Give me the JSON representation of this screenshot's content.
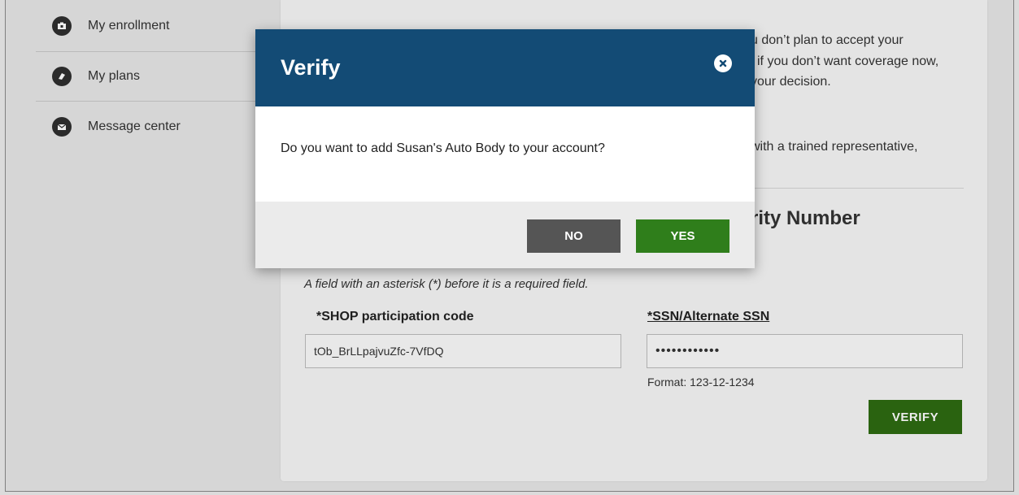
{
  "sidebar": {
    "items": [
      {
        "label": "My enrollment",
        "icon": "enrollment-icon"
      },
      {
        "label": "My plans",
        "icon": "plans-icon"
      },
      {
        "label": "Message center",
        "icon": "envelope-icon"
      }
    ]
  },
  "background": {
    "text_line_1": "u don’t plan to accept your",
    "text_line_2": "if you don’t want coverage now,",
    "text_line_3": "your decision.",
    "text_line_4": "with a trained representative,",
    "heading": "rity Number",
    "required_note": "A field with an asterisk (*) before it is a required field.",
    "participation_label": "*SHOP participation code",
    "participation_value": "tOb_BrLLpajvuZfc-7VfDQ",
    "ssn_label": "*SSN/Alternate SSN",
    "ssn_value": "••••••••••••",
    "ssn_format": "Format: 123-12-1234",
    "verify_button": "VERIFY"
  },
  "modal": {
    "title": "Verify",
    "message": "Do you want to add Susan's Auto Body to your account?",
    "no_button": "NO",
    "yes_button": "YES"
  },
  "colors": {
    "modal_header": "#134b75",
    "yes_button": "#2f7e1b",
    "no_button": "#555555",
    "verify_button": "#2e6b12"
  }
}
